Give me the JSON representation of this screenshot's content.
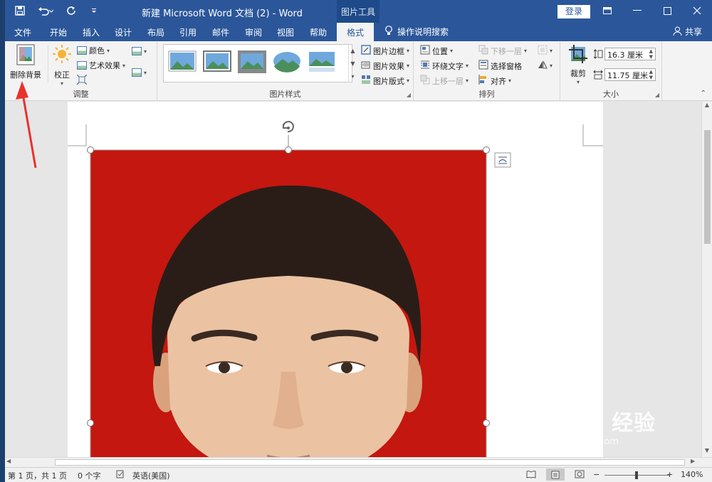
{
  "window": {
    "title": "新建 Microsoft Word 文档 (2)  -  Word",
    "context_tools": "图片工具",
    "login": "登录"
  },
  "tabs": [
    "文件",
    "开始",
    "插入",
    "设计",
    "布局",
    "引用",
    "邮件",
    "审阅",
    "视图",
    "帮助",
    "格式"
  ],
  "active_tab": "格式",
  "tell_me": "操作说明搜索",
  "share": "共享",
  "ribbon": {
    "adjust": {
      "label": "调整",
      "remove_bg": "删除背景",
      "corrections": "校正",
      "color": "颜色",
      "artistic": "艺术效果"
    },
    "styles": {
      "label": "图片样式",
      "border": "图片边框",
      "effects": "图片效果",
      "layout": "图片版式"
    },
    "arrange": {
      "label": "排列",
      "position": "位置",
      "wrap": "环绕文字",
      "forward": "上移一层",
      "backward": "下移一层",
      "selection_pane": "选择窗格",
      "align": "对齐"
    },
    "size": {
      "label": "大小",
      "crop": "裁剪",
      "height": "16.3 厘米",
      "width": "11.75 厘米"
    }
  },
  "status": {
    "page": "第 1 页，共 1 页",
    "words": "0 个字",
    "language": "英语(美国)",
    "zoom": "140%"
  },
  "watermark": {
    "brand": "Bai du 经验",
    "url": "jingyan.baidu.com"
  },
  "colors": {
    "word_blue": "#2b579a",
    "photo_background": "#c4170f",
    "annotation_arrow": "#e8322d"
  }
}
